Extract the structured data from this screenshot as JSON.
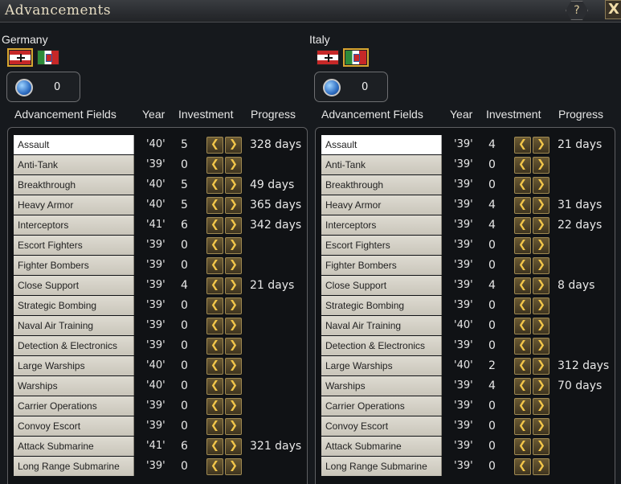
{
  "window": {
    "title": "Advancements",
    "help_label": "?",
    "close_label": "X"
  },
  "columns": {
    "field": "Advancement Fields",
    "year": "Year",
    "investment": "Investment",
    "progress": "Progress"
  },
  "left": {
    "country": "Germany",
    "counter": "0",
    "rows": [
      {
        "field": "Assault",
        "year": "'40'",
        "inv": "5",
        "progress": "328 days"
      },
      {
        "field": "Anti-Tank",
        "year": "'39'",
        "inv": "0",
        "progress": ""
      },
      {
        "field": "Breakthrough",
        "year": "'40'",
        "inv": "5",
        "progress": "49 days"
      },
      {
        "field": "Heavy Armor",
        "year": "'40'",
        "inv": "5",
        "progress": "365 days"
      },
      {
        "field": "Interceptors",
        "year": "'41'",
        "inv": "6",
        "progress": "342 days"
      },
      {
        "field": "Escort Fighters",
        "year": "'39'",
        "inv": "0",
        "progress": ""
      },
      {
        "field": "Fighter Bombers",
        "year": "'39'",
        "inv": "0",
        "progress": ""
      },
      {
        "field": "Close Support",
        "year": "'39'",
        "inv": "4",
        "progress": "21 days"
      },
      {
        "field": "Strategic Bombing",
        "year": "'39'",
        "inv": "0",
        "progress": ""
      },
      {
        "field": "Naval Air Training",
        "year": "'39'",
        "inv": "0",
        "progress": ""
      },
      {
        "field": "Detection & Electronics",
        "year": "'39'",
        "inv": "0",
        "progress": ""
      },
      {
        "field": "Large Warships",
        "year": "'40'",
        "inv": "0",
        "progress": ""
      },
      {
        "field": "Warships",
        "year": "'40'",
        "inv": "0",
        "progress": ""
      },
      {
        "field": "Carrier Operations",
        "year": "'39'",
        "inv": "0",
        "progress": ""
      },
      {
        "field": "Convoy Escort",
        "year": "'39'",
        "inv": "0",
        "progress": ""
      },
      {
        "field": "Attack Submarine",
        "year": "'41'",
        "inv": "6",
        "progress": "321 days"
      },
      {
        "field": "Long Range Submarine",
        "year": "'39'",
        "inv": "0",
        "progress": ""
      }
    ]
  },
  "right": {
    "country": "Italy",
    "counter": "0",
    "rows": [
      {
        "field": "Assault",
        "year": "'39'",
        "inv": "4",
        "progress": "21 days"
      },
      {
        "field": "Anti-Tank",
        "year": "'39'",
        "inv": "0",
        "progress": ""
      },
      {
        "field": "Breakthrough",
        "year": "'39'",
        "inv": "0",
        "progress": ""
      },
      {
        "field": "Heavy Armor",
        "year": "'39'",
        "inv": "4",
        "progress": "31 days"
      },
      {
        "field": "Interceptors",
        "year": "'39'",
        "inv": "4",
        "progress": "22 days"
      },
      {
        "field": "Escort Fighters",
        "year": "'39'",
        "inv": "0",
        "progress": ""
      },
      {
        "field": "Fighter Bombers",
        "year": "'39'",
        "inv": "0",
        "progress": ""
      },
      {
        "field": "Close Support",
        "year": "'39'",
        "inv": "4",
        "progress": "8 days"
      },
      {
        "field": "Strategic Bombing",
        "year": "'39'",
        "inv": "0",
        "progress": ""
      },
      {
        "field": "Naval Air Training",
        "year": "'40'",
        "inv": "0",
        "progress": ""
      },
      {
        "field": "Detection & Electronics",
        "year": "'39'",
        "inv": "0",
        "progress": ""
      },
      {
        "field": "Large Warships",
        "year": "'40'",
        "inv": "2",
        "progress": "312 days"
      },
      {
        "field": "Warships",
        "year": "'39'",
        "inv": "4",
        "progress": "70 days"
      },
      {
        "field": "Carrier Operations",
        "year": "'39'",
        "inv": "0",
        "progress": ""
      },
      {
        "field": "Convoy Escort",
        "year": "'39'",
        "inv": "0",
        "progress": ""
      },
      {
        "field": "Attack Submarine",
        "year": "'39'",
        "inv": "0",
        "progress": ""
      },
      {
        "field": "Long Range Submarine",
        "year": "'39'",
        "inv": "0",
        "progress": ""
      }
    ]
  },
  "icons": {
    "decrease": "arrow-left-icon",
    "increase": "arrow-right-icon",
    "counter": "globe-icon"
  },
  "colors": {
    "accent": "#f2c64a",
    "background": "#16191d",
    "field_bg": "#dedbd2"
  }
}
